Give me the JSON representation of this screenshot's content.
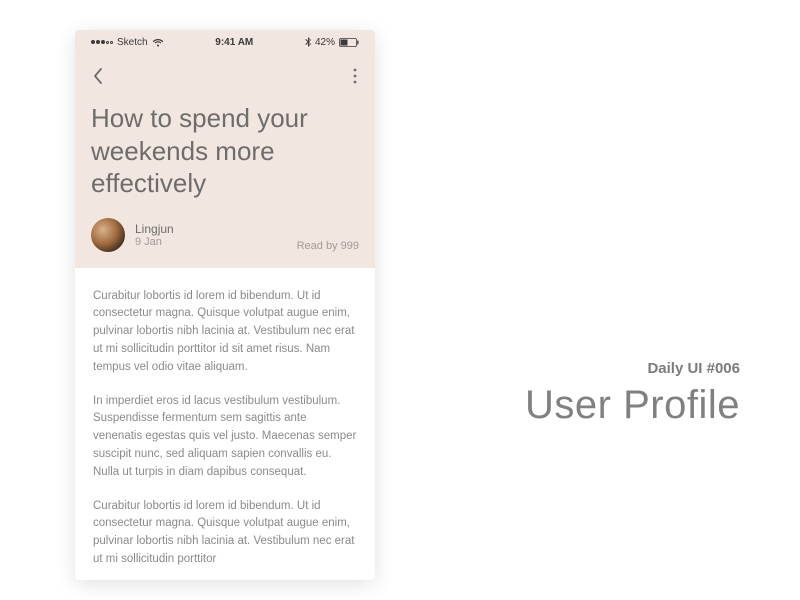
{
  "statusBar": {
    "carrier": "Sketch",
    "time": "9:41 AM",
    "battery": "42%"
  },
  "article": {
    "title": "How to spend your weekends more effectively",
    "author": "Lingjun",
    "date": "9 Jan",
    "readBy": "Read by 999",
    "paragraphs": [
      "Curabitur lobortis id lorem id bibendum. Ut id consectetur magna. Quisque volutpat augue enim, pulvinar lobortis nibh lacinia at. Vestibulum nec erat ut mi sollicitudin porttitor id sit amet risus. Nam tempus vel odio vitae aliquam.",
      "In imperdiet eros id lacus vestibulum vestibulum. Suspendisse fermentum sem sagittis ante venenatis egestas quis vel justo. Maecenas semper suscipit nunc, sed aliquam sapien convallis eu. Nulla ut turpis in diam dapibus consequat.",
      "Curabitur lobortis id lorem id bibendum. Ut id consectetur magna. Quisque volutpat augue enim, pulvinar lobortis nibh lacinia at. Vestibulum nec erat ut mi sollicitudin porttitor"
    ]
  },
  "sideLabel": {
    "small": "Daily UI #006",
    "big": "User Profile"
  }
}
